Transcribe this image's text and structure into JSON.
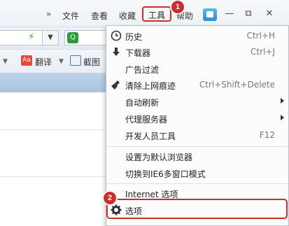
{
  "menubar": {
    "chevron": "»",
    "file": "文件",
    "view": "查看",
    "favorites": "收藏",
    "tools": "工具",
    "help": "帮助"
  },
  "window_controls": {
    "skin": "skin-icon",
    "minimize": "—",
    "restore": "⧉",
    "close": "✕"
  },
  "toolbar2": {
    "translate": "翻译",
    "screenshot": "截图"
  },
  "menu": {
    "items": [
      {
        "label": "历史",
        "shortcut": "Ctrl+H",
        "icon": "clock-icon"
      },
      {
        "label": "下载器",
        "shortcut": "Ctrl+J",
        "icon": "download-arrow-icon"
      },
      {
        "label": "广告过滤",
        "shortcut": ""
      },
      {
        "label": "清除上网痕迹",
        "shortcut": "Ctrl+Shift+Delete",
        "icon": "broom-icon"
      },
      {
        "label": "自动刷新",
        "shortcut": "",
        "submenu": true
      },
      {
        "label": "代理服务器",
        "shortcut": "",
        "submenu": true
      },
      {
        "label": "开发人员工具",
        "shortcut": "F12"
      },
      {
        "label": "设置为默认浏览器",
        "shortcut": ""
      },
      {
        "label": "切换到IE6多窗口模式",
        "shortcut": ""
      },
      {
        "label": "Internet 选项",
        "shortcut": ""
      },
      {
        "label": "选项",
        "shortcut": "",
        "icon": "gear-icon"
      }
    ]
  },
  "annotations": {
    "step1": "1",
    "step2": "2"
  },
  "colors": {
    "highlight": "#c9302c",
    "tab_strip": "#b3cce6"
  }
}
